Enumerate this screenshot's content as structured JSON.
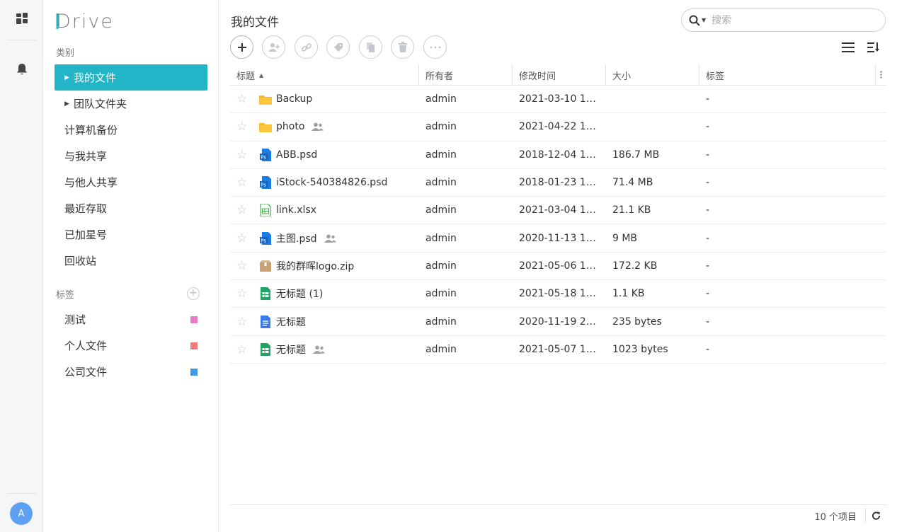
{
  "app": {
    "logo_text": "Drive",
    "avatar_initial": "A"
  },
  "rail": {
    "icons": [
      "dashboard-icon",
      "bell-icon"
    ]
  },
  "sidebar": {
    "categories_title": "类别",
    "items": [
      {
        "label": "我的文件",
        "active": true,
        "expandable": true
      },
      {
        "label": "团队文件夹",
        "active": false,
        "expandable": true
      },
      {
        "label": "计算机备份"
      },
      {
        "label": "与我共享"
      },
      {
        "label": "与他人共享"
      },
      {
        "label": "最近存取"
      },
      {
        "label": "已加星号"
      },
      {
        "label": "回收站"
      }
    ],
    "tags_title": "标签",
    "add_tag": "+",
    "tags": [
      {
        "label": "测试",
        "color": "#e87cc8"
      },
      {
        "label": "个人文件",
        "color": "#f07a7a"
      },
      {
        "label": "公司文件",
        "color": "#3f98ea"
      }
    ]
  },
  "main": {
    "title": "我的文件",
    "search": {
      "placeholder": "搜索"
    },
    "toolbar": [
      "add-icon",
      "share-user-icon",
      "link-icon",
      "tag-icon",
      "copy-icon",
      "delete-icon",
      "more-icon"
    ],
    "columns": {
      "title": "标题",
      "owner": "所有者",
      "mtime": "修改时间",
      "size": "大小",
      "tags": "标签"
    },
    "rows": [
      {
        "name": "Backup",
        "type": "folder",
        "shared": false,
        "owner": "admin",
        "mtime": "2021-03-10 1…",
        "size": "",
        "tags": "-"
      },
      {
        "name": "photo",
        "type": "folder",
        "shared": true,
        "owner": "admin",
        "mtime": "2021-04-22 1…",
        "size": "",
        "tags": "-"
      },
      {
        "name": "ABB.psd",
        "type": "psd",
        "shared": false,
        "owner": "admin",
        "mtime": "2018-12-04 1…",
        "size": "186.7 MB",
        "tags": "-"
      },
      {
        "name": "iStock-540384826.psd",
        "type": "psd",
        "shared": false,
        "owner": "admin",
        "mtime": "2018-01-23 1…",
        "size": "71.4 MB",
        "tags": "-"
      },
      {
        "name": "link.xlsx",
        "type": "xlsx",
        "shared": false,
        "owner": "admin",
        "mtime": "2021-03-04 1…",
        "size": "21.1 KB",
        "tags": "-"
      },
      {
        "name": "主图.psd",
        "type": "psd",
        "shared": true,
        "owner": "admin",
        "mtime": "2020-11-13 1…",
        "size": "9 MB",
        "tags": "-"
      },
      {
        "name": "我的群晖logo.zip",
        "type": "zip",
        "shared": false,
        "owner": "admin",
        "mtime": "2021-05-06 1…",
        "size": "172.2 KB",
        "tags": "-"
      },
      {
        "name": "无标题 (1)",
        "type": "sheet",
        "shared": false,
        "owner": "admin",
        "mtime": "2021-05-18 1…",
        "size": "1.1 KB",
        "tags": "-"
      },
      {
        "name": "无标题",
        "type": "doc",
        "shared": false,
        "owner": "admin",
        "mtime": "2020-11-19 2…",
        "size": "235 bytes",
        "tags": "-"
      },
      {
        "name": "无标题",
        "type": "sheet",
        "shared": true,
        "owner": "admin",
        "mtime": "2021-05-07 1…",
        "size": "1023 bytes",
        "tags": "-"
      }
    ],
    "footer": {
      "count": "10 个项目"
    }
  }
}
